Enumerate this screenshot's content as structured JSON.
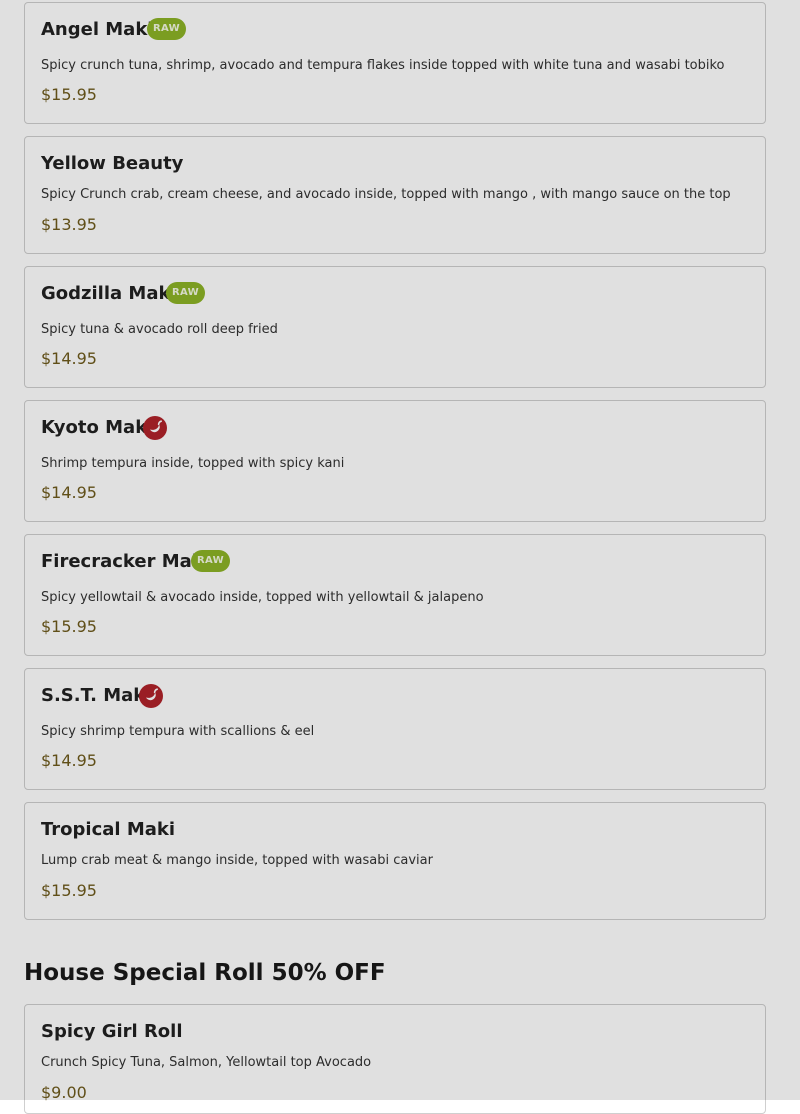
{
  "menu": {
    "items": [
      {
        "name": "Angel Maki",
        "badge": "RAW",
        "description": "Spicy crunch tuna, shrimp, avocado and tempura flakes inside topped with white tuna and wasabi tobiko",
        "price": "$15.95"
      },
      {
        "name": "Yellow Beauty",
        "description": "Spicy Crunch crab, cream cheese, and avocado inside, topped with mango , with mango sauce on the top",
        "price": "$13.95"
      },
      {
        "name": "Godzilla Maki",
        "badge": "RAW",
        "description": "Spicy tuna & avocado roll deep fried",
        "price": "$14.95"
      },
      {
        "name": "Kyoto Maki",
        "icon": "spicy-pepper-icon",
        "description": "Shrimp tempura inside, topped with spicy kani",
        "price": "$14.95"
      },
      {
        "name": "Firecracker Maki",
        "badge": "RAW",
        "description": "Spicy yellowtail & avocado inside, topped with yellowtail & jalapeno",
        "price": "$15.95"
      },
      {
        "name": "S.S.T. Maki",
        "icon": "spicy-pepper-icon",
        "description": "Spicy shrimp tempura with scallions & eel",
        "price": "$14.95"
      },
      {
        "name": "Tropical Maki",
        "description": "Lump crab meat & mango inside, topped with wasabi caviar",
        "price": "$15.95"
      }
    ]
  },
  "section": {
    "title": "House Special Roll 50% OFF",
    "items": [
      {
        "name": "Spicy Girl Roll",
        "description": "Crunch Spicy Tuna, Salmon, Yellowtail top Avocado",
        "price": "$9.00"
      }
    ]
  },
  "colors": {
    "raw_badge": "#8db326",
    "spicy_icon": "#b0232a",
    "price": "#6e5a1c",
    "overlay": "rgba(0,0,0,0.12)"
  }
}
